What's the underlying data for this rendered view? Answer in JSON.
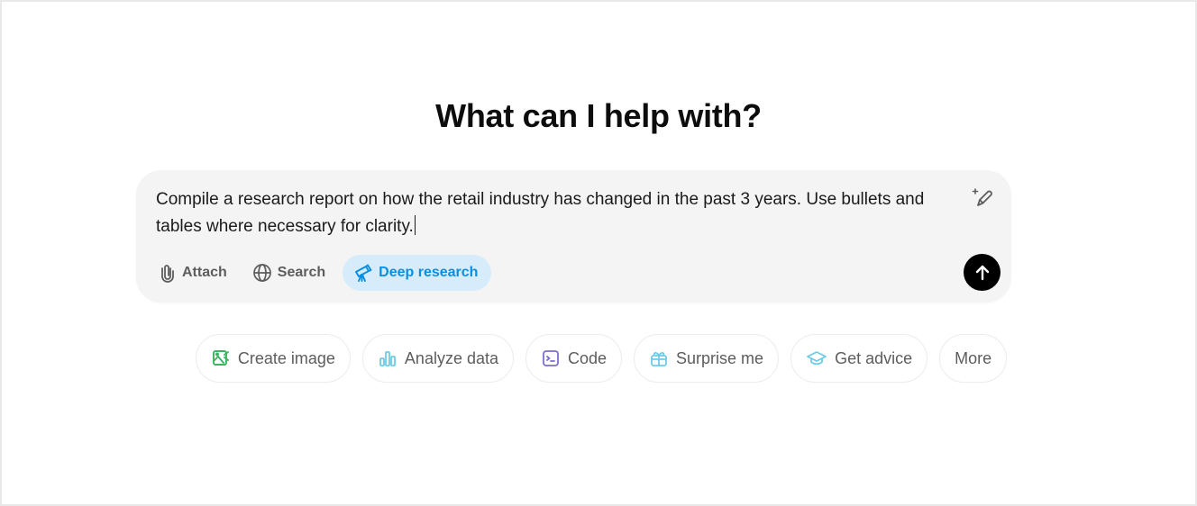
{
  "heading": "What can I help with?",
  "composer": {
    "prompt_text": "Compile a research report on how the retail industry has changed in the past 3 years. Use bullets and tables where necessary for clarity.",
    "tools": [
      {
        "label": "Attach",
        "icon": "paperclip-icon",
        "active": false
      },
      {
        "label": "Search",
        "icon": "globe-icon",
        "active": false
      },
      {
        "label": "Deep research",
        "icon": "telescope-icon",
        "active": true
      }
    ],
    "magic_icon": "sparkle-pencil-icon",
    "send_icon": "arrow-up-icon"
  },
  "suggestions": [
    {
      "label": "Create image",
      "icon": "image-icon",
      "color": "#3bb55f"
    },
    {
      "label": "Analyze data",
      "icon": "bar-chart-icon",
      "color": "#6ecbe8"
    },
    {
      "label": "Code",
      "icon": "terminal-icon",
      "color": "#7b6fd0"
    },
    {
      "label": "Surprise me",
      "icon": "gift-icon",
      "color": "#6ecbe8"
    },
    {
      "label": "Get advice",
      "icon": "graduation-cap-icon",
      "color": "#6ecbe8"
    },
    {
      "label": "More"
    }
  ],
  "colors": {
    "accent": "#0a8fe0",
    "accent_bg": "#d6ecfb",
    "composer_bg": "#f4f4f4",
    "send_button": "#000000"
  }
}
